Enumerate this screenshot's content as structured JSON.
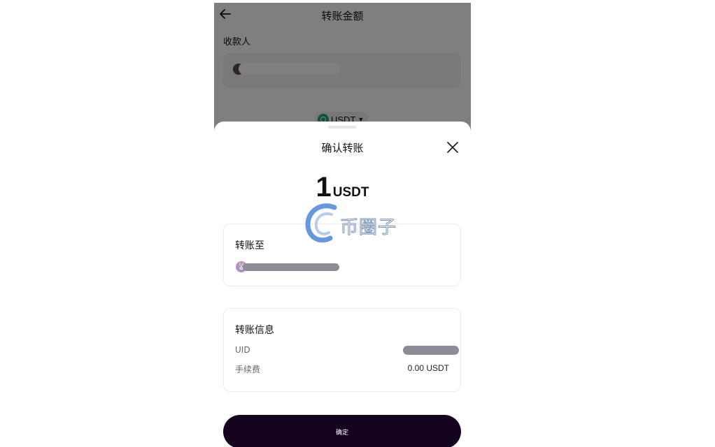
{
  "background_page": {
    "title": "转账金额",
    "recipient_label": "收款人",
    "currency": "USDT"
  },
  "sheet": {
    "title": "确认转账",
    "amount": "1",
    "amount_unit": "USDT",
    "transfer_to": {
      "title": "转账至"
    },
    "transfer_info": {
      "title": "转账信息",
      "uid_label": "UID",
      "fee_label": "手续费",
      "fee_value": "0.00 USDT"
    },
    "confirm_label": "确定"
  },
  "watermark": {
    "text": "币圈子"
  },
  "icons": {
    "back": "arrow-left-icon",
    "close": "close-icon",
    "coin": "usdt-coin-icon",
    "caret": "caret-down-icon"
  },
  "colors": {
    "confirm_button": "#14041f",
    "overlay": "rgba(0,0,0,0.5)",
    "usdt": "#26a17b"
  }
}
